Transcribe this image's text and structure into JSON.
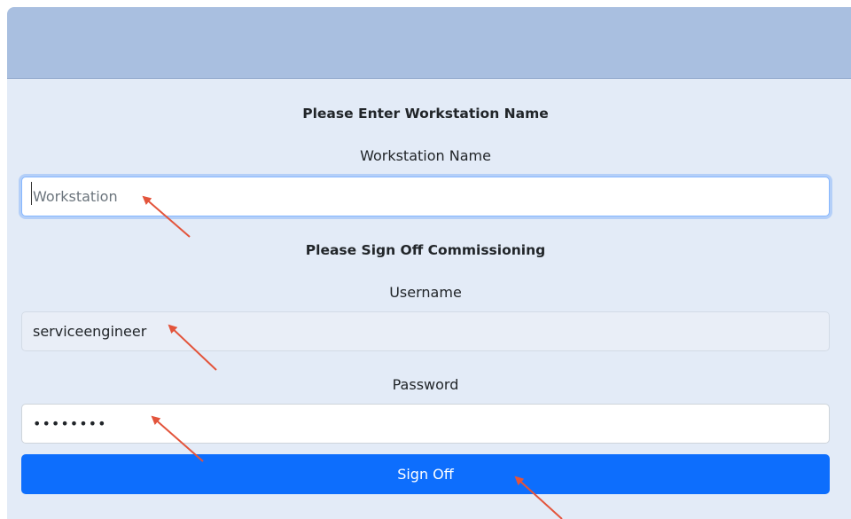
{
  "workstation": {
    "heading": "Please Enter Workstation Name",
    "label": "Workstation Name",
    "placeholder": "Workstation",
    "value": ""
  },
  "commissioning": {
    "heading": "Please Sign Off Commissioning",
    "username_label": "Username",
    "username_value": "serviceengineer",
    "password_label": "Password",
    "password_value": "••••••••"
  },
  "actions": {
    "sign_off_label": "Sign Off"
  },
  "colors": {
    "header_bar": "#a9bfe0",
    "panel_background": "#e3ebf7",
    "primary_button": "#0d6efd",
    "annotation_arrow": "#e3543b"
  }
}
